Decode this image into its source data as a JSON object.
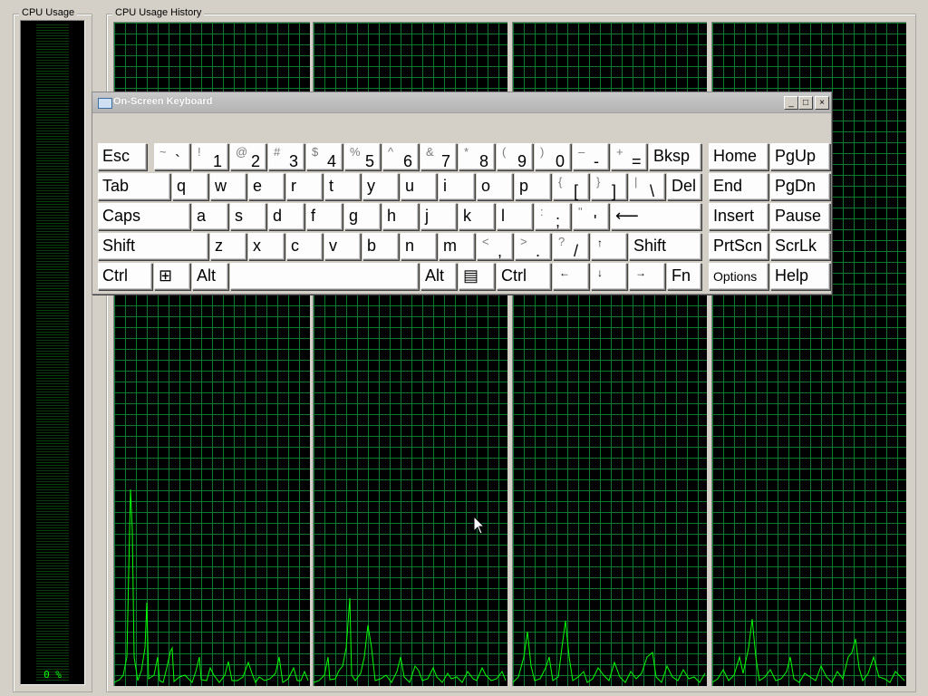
{
  "cpu_usage": {
    "label": "CPU Usage",
    "value_text": "0 %"
  },
  "cpu_history": {
    "label": "CPU Usage History"
  },
  "osk": {
    "title": "On-Screen Keyboard",
    "title_buttons": [
      "_",
      "□",
      "×"
    ],
    "keys": [
      {
        "id": "esc",
        "label": "Esc"
      },
      {
        "id": "tilde",
        "sup": "~",
        "label": "`"
      },
      {
        "id": "1",
        "sup": "!",
        "label": "1"
      },
      {
        "id": "2",
        "sup": "@",
        "label": "2"
      },
      {
        "id": "3",
        "sup": "#",
        "label": "3"
      },
      {
        "id": "4",
        "sup": "$",
        "label": "4"
      },
      {
        "id": "5",
        "sup": "%",
        "label": "5"
      },
      {
        "id": "6",
        "sup": "^",
        "label": "6"
      },
      {
        "id": "7",
        "sup": "&",
        "label": "7"
      },
      {
        "id": "8",
        "sup": "*",
        "label": "8"
      },
      {
        "id": "9",
        "sup": "(",
        "label": "9"
      },
      {
        "id": "0",
        "sup": ")",
        "label": "0"
      },
      {
        "id": "minus",
        "sup": "–",
        "label": "-"
      },
      {
        "id": "equals",
        "sup": "+",
        "label": "="
      },
      {
        "id": "bksp",
        "label": "Bksp"
      },
      {
        "id": "tab",
        "label": "Tab"
      },
      {
        "id": "q",
        "label": "q"
      },
      {
        "id": "w",
        "label": "w"
      },
      {
        "id": "e",
        "label": "e"
      },
      {
        "id": "r",
        "label": "r"
      },
      {
        "id": "t",
        "label": "t"
      },
      {
        "id": "y",
        "label": "y"
      },
      {
        "id": "u",
        "label": "u"
      },
      {
        "id": "i",
        "label": "i"
      },
      {
        "id": "o",
        "label": "o"
      },
      {
        "id": "p",
        "label": "p"
      },
      {
        "id": "lbracket",
        "sup": "{",
        "label": "["
      },
      {
        "id": "rbracket",
        "sup": "}",
        "label": "]"
      },
      {
        "id": "backslash",
        "sup": "|",
        "label": "\\"
      },
      {
        "id": "del",
        "label": "Del"
      },
      {
        "id": "caps",
        "label": "Caps"
      },
      {
        "id": "a",
        "label": "a"
      },
      {
        "id": "s",
        "label": "s"
      },
      {
        "id": "d",
        "label": "d"
      },
      {
        "id": "f",
        "label": "f"
      },
      {
        "id": "g",
        "label": "g"
      },
      {
        "id": "h",
        "label": "h"
      },
      {
        "id": "j",
        "label": "j"
      },
      {
        "id": "k",
        "label": "k"
      },
      {
        "id": "l",
        "label": "l"
      },
      {
        "id": "semicolon",
        "sup": ":",
        "label": ";"
      },
      {
        "id": "quote",
        "sup": "\"",
        "label": "'"
      },
      {
        "id": "enter",
        "label": "⟵"
      },
      {
        "id": "lshift",
        "label": "Shift"
      },
      {
        "id": "z",
        "label": "z"
      },
      {
        "id": "x",
        "label": "x"
      },
      {
        "id": "c",
        "label": "c"
      },
      {
        "id": "v",
        "label": "v"
      },
      {
        "id": "b",
        "label": "b"
      },
      {
        "id": "n",
        "label": "n"
      },
      {
        "id": "m",
        "label": "m"
      },
      {
        "id": "comma",
        "sup": "<",
        "label": ","
      },
      {
        "id": "period",
        "sup": ">",
        "label": "."
      },
      {
        "id": "slash",
        "sup": "?",
        "label": "/"
      },
      {
        "id": "up",
        "label": "↑"
      },
      {
        "id": "rshift",
        "label": "Shift"
      },
      {
        "id": "lctrl",
        "label": "Ctrl"
      },
      {
        "id": "win",
        "label": "⊞"
      },
      {
        "id": "lalt",
        "label": "Alt"
      },
      {
        "id": "space",
        "label": ""
      },
      {
        "id": "ralt",
        "label": "Alt"
      },
      {
        "id": "menu",
        "label": "▤"
      },
      {
        "id": "rctrl",
        "label": "Ctrl"
      },
      {
        "id": "left",
        "label": "←"
      },
      {
        "id": "down",
        "label": "↓"
      },
      {
        "id": "right",
        "label": "→"
      },
      {
        "id": "fn",
        "label": "Fn"
      },
      {
        "id": "home",
        "label": "Home"
      },
      {
        "id": "pgup",
        "label": "PgUp"
      },
      {
        "id": "end",
        "label": "End"
      },
      {
        "id": "pgdn",
        "label": "PgDn"
      },
      {
        "id": "insert",
        "label": "Insert"
      },
      {
        "id": "pause",
        "label": "Pause"
      },
      {
        "id": "prtscn",
        "label": "PrtScn"
      },
      {
        "id": "scrlk",
        "label": "ScrLk"
      },
      {
        "id": "options",
        "label": "Options"
      },
      {
        "id": "help",
        "label": "Help"
      }
    ]
  },
  "colors": {
    "graph_bg": "#000000",
    "grid": "#0a7a2c",
    "trace": "#00ff00",
    "window_bg": "#d4d0c8"
  }
}
